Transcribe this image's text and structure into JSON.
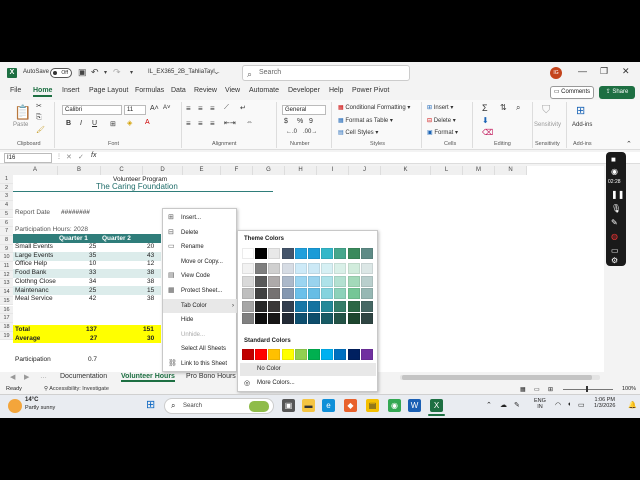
{
  "titlebar": {
    "autosave_label": "AutoSave",
    "autosave_state": "Off",
    "filename": "IL_EX365_2B_TahliaTayl...",
    "search_placeholder": "Search",
    "avatar_initials": "IG"
  },
  "menu": {
    "tabs": [
      "File",
      "Home",
      "Insert",
      "Page Layout",
      "Formulas",
      "Data",
      "Review",
      "View",
      "Automate",
      "Developer",
      "Help",
      "Power Pivot"
    ],
    "active": "Home",
    "comments_label": "Comments",
    "share_label": "Share"
  },
  "ribbon": {
    "paste": "Paste",
    "font_name": "Calibri",
    "font_size": "11",
    "number_format": "General",
    "conditional_formatting": "Conditional Formatting",
    "format_as_table": "Format as Table",
    "cell_styles": "Cell Styles",
    "insert": "Insert",
    "delete": "Delete",
    "format": "Format",
    "sensitivity": "Sensitivity",
    "addins": "Add-ins",
    "groups": [
      "Clipboard",
      "Font",
      "Alignment",
      "Number",
      "Styles",
      "Cells",
      "Editing",
      "Sensitivity",
      "Add-ins"
    ]
  },
  "formula_bar": {
    "name_box": "I16",
    "fx": "fx"
  },
  "columns": [
    "A",
    "B",
    "C",
    "D",
    "E",
    "F",
    "G",
    "H",
    "I",
    "J",
    "K",
    "L",
    "M",
    "N"
  ],
  "rows": [
    "1",
    "2",
    "3",
    "4",
    "5",
    "6",
    "7",
    "8",
    "9",
    "10",
    "11",
    "12",
    "13",
    "14",
    "15",
    "16",
    "17",
    "18",
    "19"
  ],
  "sheet": {
    "program_title": "Volunteer Program",
    "foundation": "The Caring Foundation",
    "report_date_label": "Report Date",
    "report_date_value": "########",
    "participation_hours": "Participation Hours: 2028",
    "quarter1": "Quarter 1",
    "quarter2": "Quarter 2",
    "data_rows": [
      {
        "name": "Small Events",
        "q1": "25",
        "q2": "20"
      },
      {
        "name": "Large Events",
        "q1": "35",
        "q2": "43"
      },
      {
        "name": "Office Help",
        "q1": "10",
        "q2": "12"
      },
      {
        "name": "Food Bank",
        "q1": "33",
        "q2": "38"
      },
      {
        "name": "Clothng Close",
        "q1": "34",
        "q2": "38"
      },
      {
        "name": "Maintenanc",
        "q1": "25",
        "q2": "15"
      },
      {
        "name": "Meal Service",
        "q1": "42",
        "q2": "38"
      }
    ],
    "total_label": "Total",
    "total_q1": "137",
    "total_q2": "151",
    "average_label": "Average",
    "average_q1": "27",
    "average_q2": "30",
    "participation_label": "Participation",
    "participation_value": "0.7"
  },
  "sheet_tabs": [
    "Documentation",
    "Volunteer Hours",
    "Pro Bono Hours"
  ],
  "active_sheet": "Volunteer Hours",
  "status": {
    "ready": "Ready",
    "accessibility": "Accessibility: Investigate",
    "zoom": "100%"
  },
  "context_menu": {
    "items": [
      {
        "label": "Insert...",
        "icon": "insert-icon",
        "disabled": false
      },
      {
        "label": "Delete",
        "icon": "delete-icon",
        "disabled": false
      },
      {
        "label": "Rename",
        "icon": "rename-icon",
        "disabled": false
      },
      {
        "label": "Move or Copy...",
        "icon": "",
        "disabled": false
      },
      {
        "label": "View Code",
        "icon": "view-code-icon",
        "disabled": false
      },
      {
        "label": "Protect Sheet...",
        "icon": "protect-sheet-icon",
        "disabled": false
      },
      {
        "label": "Tab Color",
        "icon": "",
        "disabled": false,
        "submenu": true
      },
      {
        "label": "Hide",
        "icon": "",
        "disabled": false
      },
      {
        "label": "Unhide...",
        "icon": "",
        "disabled": true
      },
      {
        "label": "Select All Sheets",
        "icon": "",
        "disabled": false
      },
      {
        "label": "Link to this Sheet",
        "icon": "link-icon",
        "disabled": false
      }
    ]
  },
  "tab_color_menu": {
    "theme_label": "Theme Colors",
    "standard_label": "Standard Colors",
    "no_color": "No Color",
    "more_colors": "More Colors...",
    "theme_top": [
      "#ffffff",
      "#000000",
      "#e8e8e8",
      "#44546a",
      "#1f9fdc",
      "#1a9bd7",
      "#33b7c9",
      "#46a78c",
      "#3a8a5c",
      "#5e8b86"
    ],
    "theme_columns": [
      [
        "#f2f2f2",
        "#d9d9d9",
        "#bfbfbf",
        "#a6a6a6",
        "#808080"
      ],
      [
        "#7f7f7f",
        "#595959",
        "#404040",
        "#262626",
        "#0d0d0d"
      ],
      [
        "#d0d0d0",
        "#aeaaaa",
        "#757171",
        "#3a3838",
        "#171616"
      ],
      [
        "#d6dce4",
        "#acb9ca",
        "#8497b0",
        "#333f4f",
        "#222a35"
      ],
      [
        "#cdeaf8",
        "#9bd5f1",
        "#6ac0ea",
        "#1677a7",
        "#0e4f6f"
      ],
      [
        "#cce9f6",
        "#99d3ee",
        "#66bde5",
        "#1473a0",
        "#0d4d6b"
      ],
      [
        "#d6f0f4",
        "#ade2e9",
        "#84d3de",
        "#238998",
        "#175b65"
      ],
      [
        "#d9f0e8",
        "#b3e1d1",
        "#8dd2ba",
        "#347d68",
        "#235346"
      ],
      [
        "#d1ecdc",
        "#a3d9b9",
        "#75c696",
        "#2b6745",
        "#1d452e"
      ],
      [
        "#dce7e6",
        "#b9cfcd",
        "#96b8b4",
        "#466864",
        "#2f4543"
      ]
    ],
    "standard": [
      "#c00000",
      "#ff0000",
      "#ffc000",
      "#ffff00",
      "#92d050",
      "#00b050",
      "#00b0f0",
      "#0070c0",
      "#002060",
      "#7030a0"
    ]
  },
  "taskbar": {
    "weather_temp": "14°C",
    "weather_desc": "Partly sunny",
    "search_placeholder": "Search",
    "lang_line1": "ENG",
    "lang_line2": "IN",
    "time": "1:06 PM",
    "date": "1/3/2026"
  },
  "recorder": {
    "timer": "02:28"
  },
  "colors": {
    "excel_green": "#1d6f42",
    "header_fill": "#2f7d7a",
    "alt_row": "#dceceb",
    "highlight": "#ffff00"
  }
}
